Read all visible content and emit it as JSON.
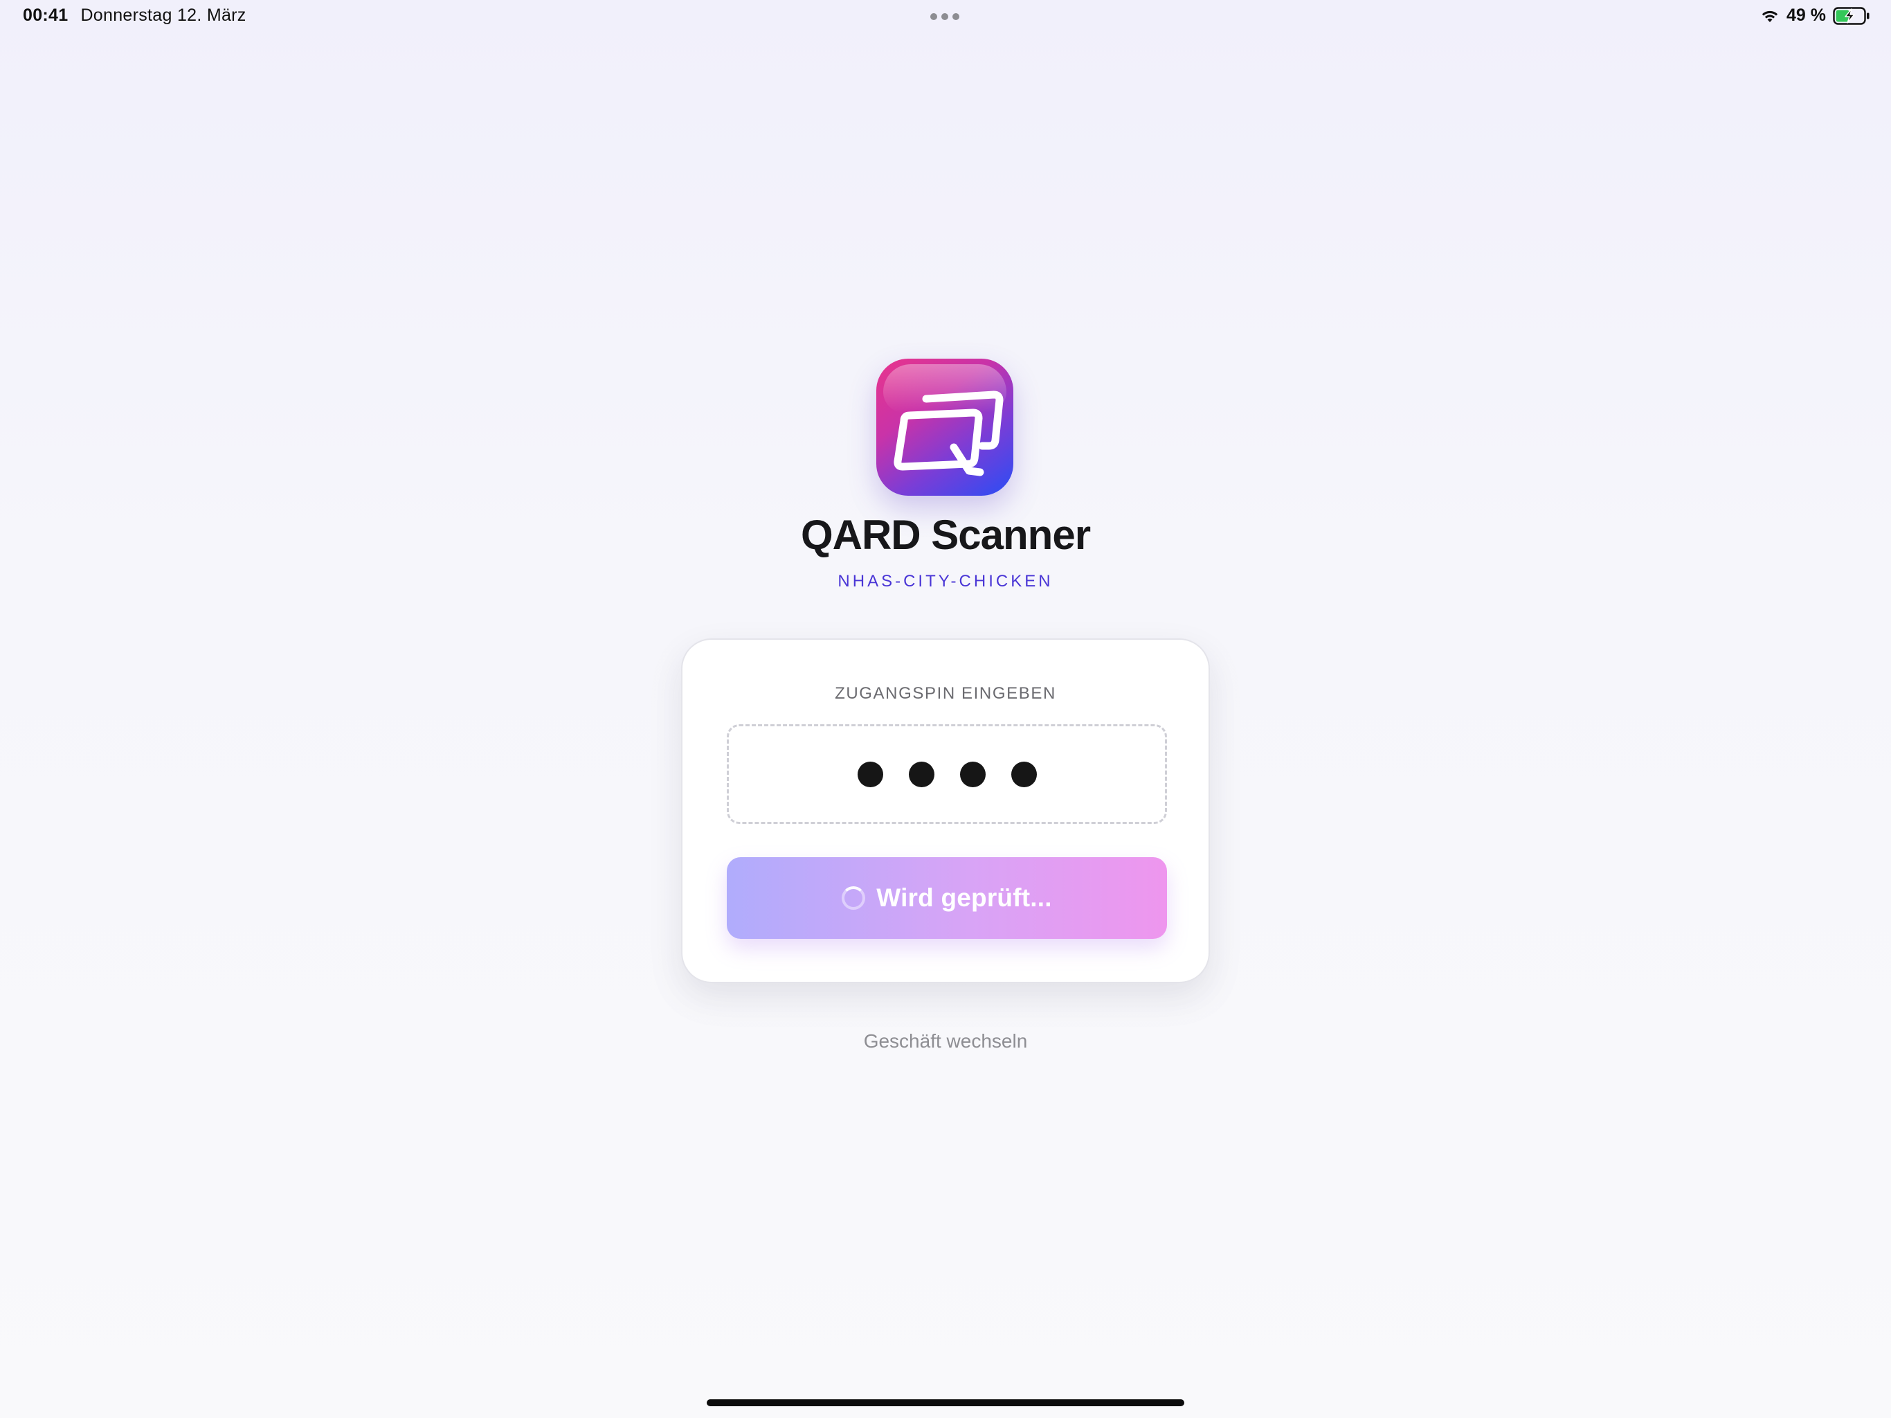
{
  "status_bar": {
    "time": "00:41",
    "date": "Donnerstag 12. März",
    "battery_percent": "49 %",
    "battery_level": 0.49,
    "icons": [
      "wifi-icon",
      "battery-charging-icon"
    ]
  },
  "app": {
    "title": "QARD Scanner",
    "store_id": "NHAS-CITY-CHICKEN",
    "icon": "qard-logo-icon"
  },
  "pin": {
    "label": "ZUGANGSPIN EINGEBEN",
    "entered_digits": 4
  },
  "verify_button": {
    "label": "Wird geprüft...",
    "state": "loading"
  },
  "switch_store": {
    "label": "Geschäft wechseln"
  },
  "colors": {
    "accent": "#4a36d6",
    "button_start": "#b0acfc",
    "button_end": "#ee96ee",
    "logo_pink": "#e8348c",
    "logo_blue": "#2a4df5"
  }
}
